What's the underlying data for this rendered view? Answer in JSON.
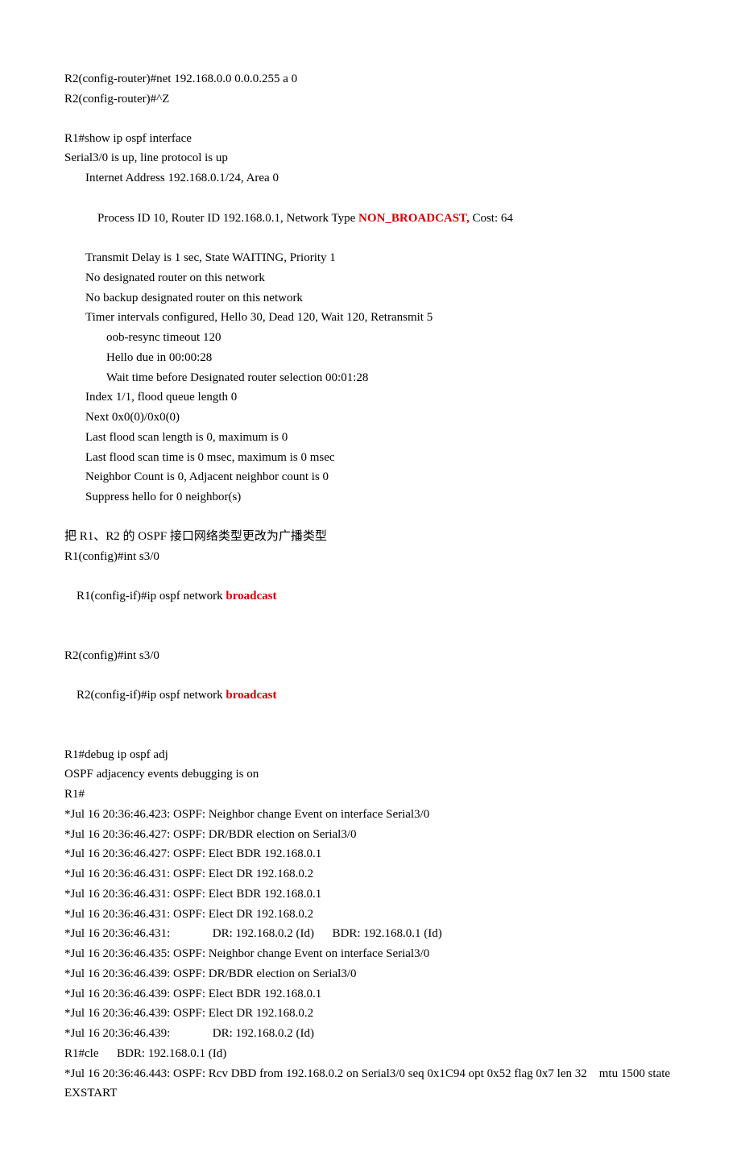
{
  "cfg": {
    "l1": "R2(config-router)#net 192.168.0.0 0.0.0.255 a 0",
    "l2": "R2(config-router)#^Z"
  },
  "show": {
    "cmd": "R1#show ip ospf interface",
    "s1": "Serial3/0 is up, line protocol is up",
    "s2": "Internet Address 192.168.0.1/24, Area 0",
    "s3a": "Process ID 10, Router ID 192.168.0.1, Network Type ",
    "s3b": "NON_BROADCAST,",
    "s3c": " Cost: 64",
    "s4": "Transmit Delay is 1 sec, State WAITING, Priority 1",
    "s5": "No designated router on this network",
    "s6": "No backup designated router on this network",
    "s7": "Timer intervals configured, Hello 30, Dead 120, Wait 120, Retransmit 5",
    "s8": "oob-resync timeout 120",
    "s9": "Hello due in 00:00:28",
    "s10": "Wait time before Designated router selection 00:01:28",
    "s11": "Index 1/1, flood queue length 0",
    "s12": "Next 0x0(0)/0x0(0)",
    "s13": "Last flood scan length is 0, maximum is 0",
    "s14": "Last flood scan time is 0 msec, maximum is 0 msec",
    "s15": "Neighbor Count is 0, Adjacent neighbor count is 0",
    "s16": "Suppress hello for 0 neighbor(s)"
  },
  "change": {
    "note": "把 R1、R2 的 OSPF 接口网络类型更改为广播类型",
    "r1a": "R1(config)#int s3/0",
    "r1b_pre": "R1(config-if)#ip ospf network ",
    "r1b_kw": "broadcast",
    "r2a": "R2(config)#int s3/0",
    "r2b_pre": "R2(config-if)#ip ospf network ",
    "r2b_kw": "broadcast"
  },
  "debug": {
    "d0": "R1#debug ip ospf adj",
    "d1": "OSPF adjacency events debugging is on",
    "d2": "R1#",
    "d3": "*Jul 16 20:36:46.423: OSPF: Neighbor change Event on interface Serial3/0",
    "d4": "*Jul 16 20:36:46.427: OSPF: DR/BDR election on Serial3/0",
    "d5": "*Jul 16 20:36:46.427: OSPF: Elect BDR 192.168.0.1",
    "d6": "*Jul 16 20:36:46.431: OSPF: Elect DR 192.168.0.2",
    "d7": "*Jul 16 20:36:46.431: OSPF: Elect BDR 192.168.0.1",
    "d8": "*Jul 16 20:36:46.431: OSPF: Elect DR 192.168.0.2",
    "d9": "*Jul 16 20:36:46.431:              DR: 192.168.0.2 (Id)      BDR: 192.168.0.1 (Id)",
    "d10": "*Jul 16 20:36:46.435: OSPF: Neighbor change Event on interface Serial3/0",
    "d11": "*Jul 16 20:36:46.439: OSPF: DR/BDR election on Serial3/0",
    "d12": "*Jul 16 20:36:46.439: OSPF: Elect BDR 192.168.0.1",
    "d13": "*Jul 16 20:36:46.439: OSPF: Elect DR 192.168.0.2",
    "d14": "*Jul 16 20:36:46.439:              DR: 192.168.0.2 (Id)",
    "d15": "R1#cle      BDR: 192.168.0.1 (Id)",
    "d16": "*Jul 16 20:36:46.443: OSPF: Rcv DBD from 192.168.0.2 on Serial3/0 seq 0x1C94 opt 0x52 flag 0x7 len 32    mtu 1500 state EXSTART"
  }
}
